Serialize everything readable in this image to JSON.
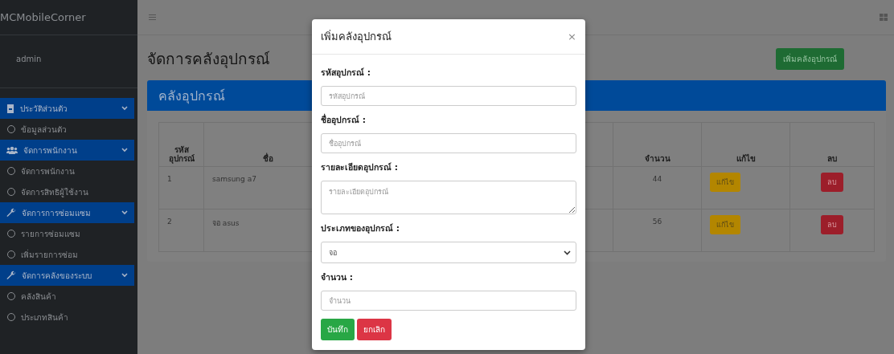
{
  "sidebar": {
    "brand": "MCMobileCorner",
    "user": "admin",
    "groups": [
      {
        "label": "ประวัติส่วนตัว",
        "kind": "card",
        "expanded": true,
        "items": [
          "ข้อมูลส่วนตัว"
        ]
      },
      {
        "label": "จัดการพนักงาน",
        "kind": "users",
        "expanded": true,
        "items": [
          "จัดการพนักงาน",
          "จัดการสิทธิผู้ใช้งาน"
        ]
      },
      {
        "label": "จัดการการซ่อมแซม",
        "kind": "wrench",
        "expanded": true,
        "items": [
          "รายการซ่อมแซม",
          "เพิ่มรายการซ่อม"
        ]
      },
      {
        "label": "จัดการคลังของระบบ",
        "kind": "wrench",
        "expanded": true,
        "items": [
          "คลังสินค้า",
          "ประเภทสินค้า"
        ]
      }
    ]
  },
  "page": {
    "title": "จัดการคลังอุปกรณ์",
    "add_button": "เพิ่มคลังอุปกรณ์"
  },
  "card": {
    "title": "คลังอุปกรณ์",
    "table": {
      "columns": [
        "รหัส\nอุปกรณ์",
        "ชื่อ",
        "จำนวน",
        "แก้ไข",
        "ลบ"
      ],
      "rows": [
        {
          "id": "1",
          "name": "samsung a7",
          "quantity": "44",
          "edit": "แก้ไข",
          "delete": "ลบ"
        },
        {
          "id": "2",
          "name": "จอ asus",
          "quantity": "56",
          "edit": "แก้ไข",
          "delete": "ลบ"
        }
      ]
    }
  },
  "modal": {
    "title": "เพิ่มคลังอุปกรณ์",
    "close": "×",
    "fields": [
      {
        "kind": "input",
        "label": "รหัสอุปกรณ์ :",
        "placeholder": "รหัสอุปกรณ์"
      },
      {
        "kind": "input",
        "label": "ชื่ออุปกรณ์ :",
        "placeholder": "ชื่ออุปกรณ์"
      },
      {
        "kind": "textarea",
        "label": "รายละเอียดอุปกรณ์ :",
        "placeholder": "รายละเอียดอุปกรณ์"
      },
      {
        "kind": "select",
        "label": "ประเภทของอุปกรณ์ :",
        "value": "จอ"
      },
      {
        "kind": "input",
        "label": "จำนวน :",
        "placeholder": "จำนวน"
      }
    ],
    "save": "บันทึก",
    "cancel": "ยกเลิก"
  }
}
